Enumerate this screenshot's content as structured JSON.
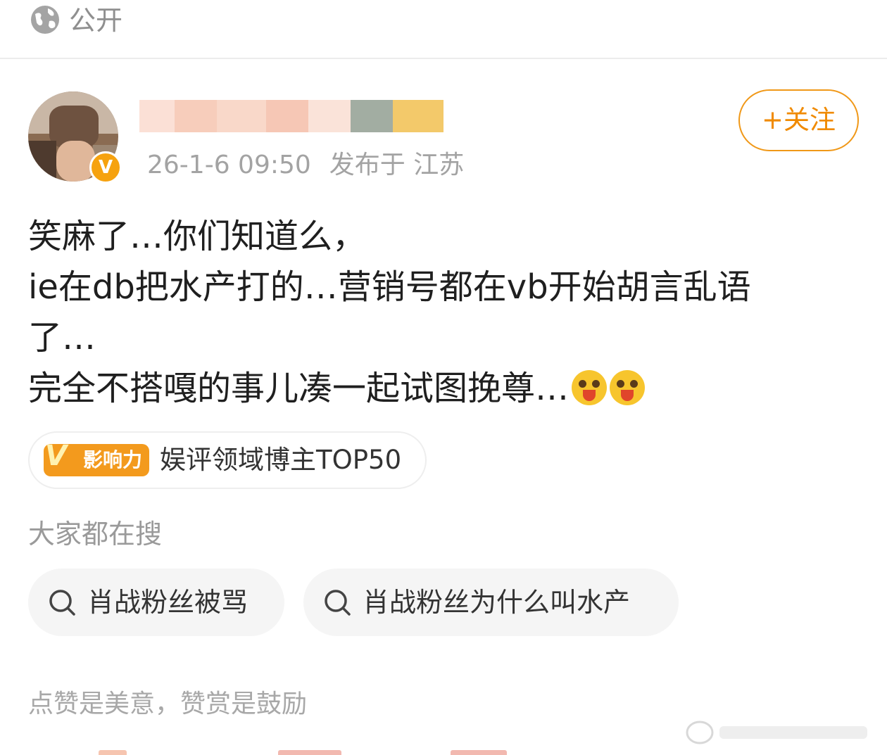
{
  "topbar": {
    "icon": "globe-icon",
    "label": "公开"
  },
  "post": {
    "timestamp": "26-1-6 09:50",
    "location": "发布于 江苏",
    "follow_label": "+关注",
    "text_lines": [
      "笑麻了…你们知道么，",
      "ie在db把水产打的…营销号都在vb开始胡言乱语",
      "了…",
      "完全不搭嘎的事儿凑一起试图挽尊…"
    ],
    "emoji_count": 2
  },
  "influence": {
    "badge_label": "影响力",
    "text": "娱评领域博主TOP50"
  },
  "searches": {
    "heading": "大家都在搜",
    "items": [
      {
        "label": "肖战粉丝被骂"
      },
      {
        "label": "肖战粉丝为什么叫水产"
      }
    ]
  },
  "reward_text": "点赞是美意，赞赏是鼓励",
  "colors": {
    "accent": "#f08a00",
    "verified": "#f6a20f",
    "muted_text": "#a3a3a3",
    "chip_bg": "#f5f5f5"
  }
}
